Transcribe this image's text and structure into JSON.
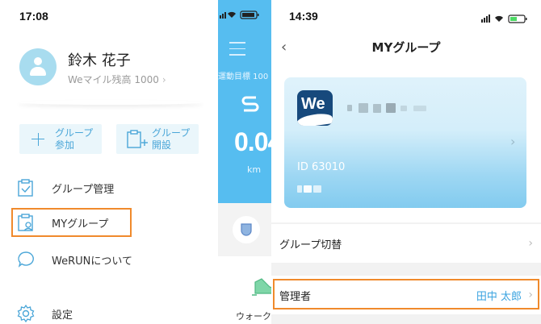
{
  "left": {
    "time": "17:08",
    "user": {
      "name": "鈴木 花子",
      "miles": "Weマイル残高 1000",
      "miles_chevron": "›"
    },
    "quick_buttons": [
      {
        "label": "グループ\n参加",
        "icon": "plus-icon"
      },
      {
        "label": "グループ\n開設",
        "icon": "clipboard-plus-icon"
      }
    ],
    "menu": [
      {
        "label": "グループ管理",
        "icon": "clipboard-check-icon"
      },
      {
        "label": "MYグループ",
        "icon": "clipboard-user-icon",
        "highlighted": true
      },
      {
        "label": "WeRUNについて",
        "icon": "chat-bubble-icon"
      },
      {
        "label": "設定",
        "icon": "gear-icon"
      }
    ]
  },
  "middle": {
    "goal": "運動目標 100",
    "distance": "0.04",
    "unit": "km",
    "walk_label": "ウォーク..."
  },
  "right": {
    "time": "14:39",
    "title": "MYグループ",
    "back": "‹",
    "card": {
      "id": "ID 63010",
      "logo": "We"
    },
    "rows": [
      {
        "label": "グループ切替",
        "value": "",
        "chevron": "›"
      },
      {
        "label": "管理者",
        "value": "田中 太郎",
        "chevron": "›",
        "highlighted": true
      }
    ]
  },
  "colors": {
    "accent": "#4aa6d8",
    "highlight": "#f08a2c",
    "app_blue": "#56bdf0",
    "logo_navy": "#17497c"
  }
}
